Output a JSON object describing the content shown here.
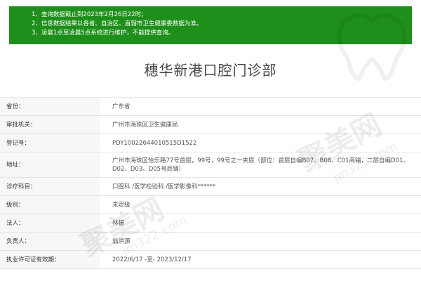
{
  "notice": {
    "lines": [
      "1、查询数据截止到2023年2月26日22时；",
      "2、信息数据结果以各省、自治区、直辖市卫生健康委数据为准。",
      "3、凌晨1点至凌晨5点系统进行维护，不能提供查询。"
    ],
    "background_color": "#1e8f1a"
  },
  "page_title": "穗华新港口腔门诊部",
  "watermark": {
    "brand": "聚美网",
    "site": "jm322.com"
  },
  "rows": [
    {
      "label": "省份：",
      "value": "广东省"
    },
    {
      "label": "审批机关：",
      "value": "广州市海珠区卫生健康局"
    },
    {
      "label": "登记号：",
      "value": "PDY10022644010515D1522"
    },
    {
      "label": "地址：",
      "value": "广州市海珠区怡乐路77号首层，99号，99号之一夹层（部位：首层自编B07、B08、C01商铺，二层自编D01、D02、D03、D05号商铺）"
    },
    {
      "label": "诊疗科目：",
      "value": "口腔科 /医学检验科 /医学影像科******"
    },
    {
      "label": "级别：",
      "value": "未定级"
    },
    {
      "label": "法人：",
      "value": "林振"
    },
    {
      "label": "负责人：",
      "value": "翁洪源"
    },
    {
      "label": "执业许可证有效期：",
      "value": "2022/6/17 -至- 2023/12/17"
    }
  ]
}
